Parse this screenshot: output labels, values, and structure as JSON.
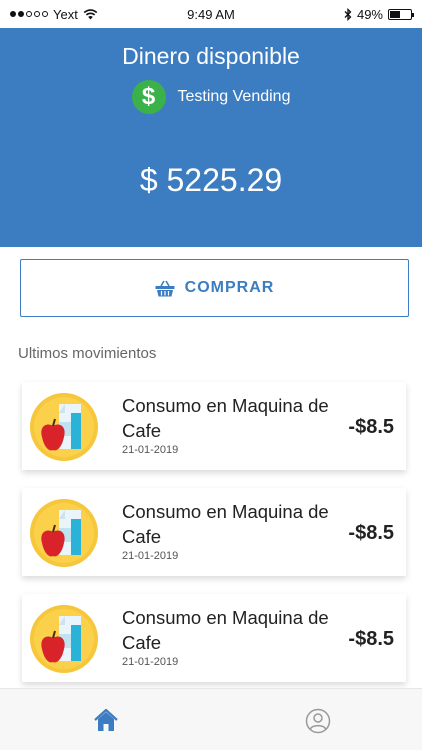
{
  "status_bar": {
    "carrier": "Yext",
    "time": "9:49 AM",
    "battery_percent": "49%",
    "battery_level": 0.49,
    "signal_bars_filled": 2,
    "signal_bars_total": 5,
    "icons": [
      "wifi-icon",
      "bluetooth-icon",
      "battery-icon"
    ]
  },
  "header": {
    "title": "Dinero disponible",
    "merchant": "Testing Vending",
    "merchant_icon": "dollar-icon",
    "balance": "$ 5225.29",
    "background_color": "#3c7dc2",
    "merchant_icon_color": "#3bb14a"
  },
  "buy_button": {
    "label": "COMPRAR",
    "icon": "basket-icon",
    "color": "#3c7dc2"
  },
  "movements": {
    "section_label": "Ultimos movimientos",
    "items": [
      {
        "title": "Consumo en Maquina de Cafe",
        "date": "21-01-2019",
        "amount": "-$8.5",
        "icon": "food-drink-icon"
      },
      {
        "title": "Consumo en Maquina de Cafe",
        "date": "21-01-2019",
        "amount": "-$8.5",
        "icon": "food-drink-icon"
      },
      {
        "title": "Consumo en Maquina de Cafe",
        "date": "21-01-2019",
        "amount": "-$8.5",
        "icon": "food-drink-icon"
      }
    ]
  },
  "tab_bar": {
    "tabs": [
      {
        "name": "home",
        "icon": "home-icon",
        "active": true
      },
      {
        "name": "profile",
        "icon": "user-icon",
        "active": false
      }
    ],
    "active_color": "#3c7dc2",
    "inactive_color": "#999999"
  }
}
